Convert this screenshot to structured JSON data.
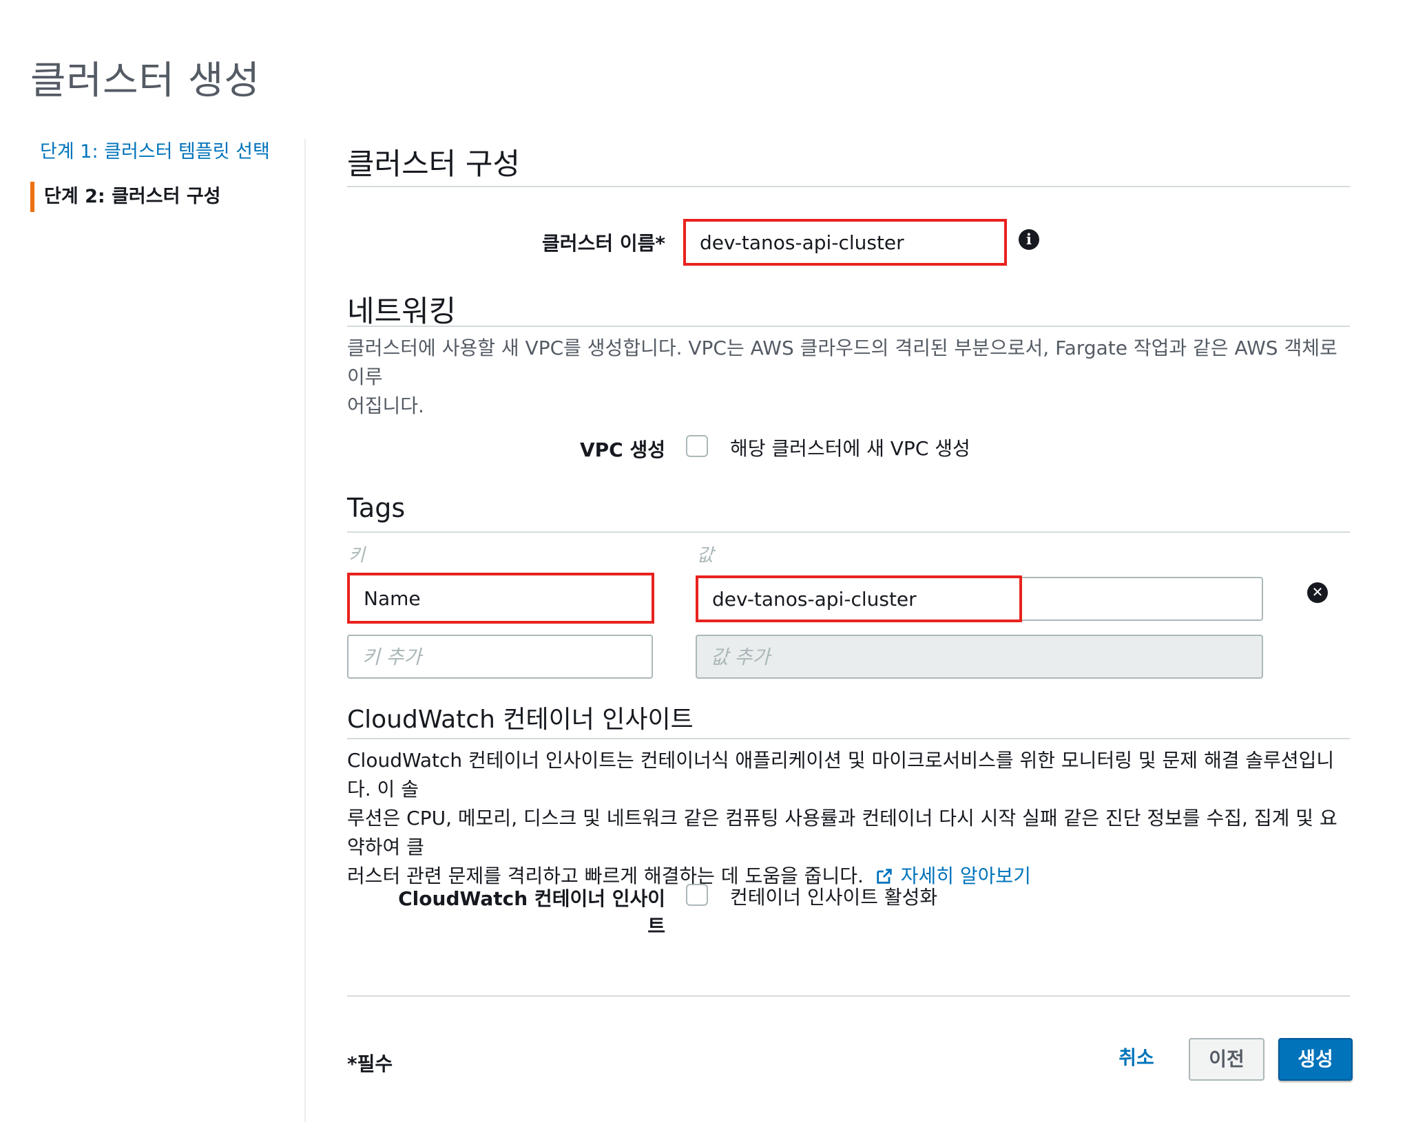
{
  "page": {
    "title": "클러스터 생성"
  },
  "sidebar": {
    "steps": [
      {
        "label": "단계 1: 클러스터 템플릿 선택"
      },
      {
        "label": "단계 2: 클러스터 구성"
      }
    ]
  },
  "config": {
    "heading": "클러스터 구성",
    "cluster_name_label": "클러스터 이름*",
    "cluster_name_value": "dev-tanos-api-cluster"
  },
  "networking": {
    "heading": "네트워킹",
    "desc_line1": "클러스터에 사용할 새 VPC를 생성합니다. VPC는 AWS 클라우드의 격리된 부분으로서, Fargate 작업과 같은 AWS 객체로 이루",
    "desc_line2": "어집니다.",
    "vpc_label": "VPC 생성",
    "vpc_checkbox_label": "해당 클러스터에 새 VPC 생성"
  },
  "tags": {
    "heading": "Tags",
    "key_header": "키",
    "value_header": "값",
    "rows": [
      {
        "key": "Name",
        "value": "dev-tanos-api-cluster"
      }
    ],
    "add_key_placeholder": "키 추가",
    "add_value_placeholder": "값 추가"
  },
  "cloudwatch": {
    "heading": "CloudWatch 컨테이너 인사이트",
    "desc_line1": "CloudWatch 컨테이너 인사이트는 컨테이너식 애플리케이션 및 마이크로서비스를 위한 모니터링 및 문제 해결 솔루션입니다. 이 솔",
    "desc_line2": "루션은 CPU, 메모리, 디스크 및 네트워크 같은 컴퓨팅 사용률과 컨테이너 다시 시작 실패 같은 진단 정보를 수집, 집계 및 요약하여 클",
    "desc_line3": "러스터 관련 문제를 격리하고 빠르게 해결하는 데 도움을 줍니다.",
    "learn_more": "자세히 알아보기",
    "toggle_label": "CloudWatch 컨테이너 인사이트",
    "checkbox_label": "컨테이너 인사이트 활성화"
  },
  "footer": {
    "required_note": "*필수",
    "cancel": "취소",
    "previous": "이전",
    "create": "생성"
  },
  "colors": {
    "link": "#0073bb",
    "primary_button": "#0073bb",
    "step_accent": "#ec7211",
    "highlight_box": "#e8221e"
  }
}
